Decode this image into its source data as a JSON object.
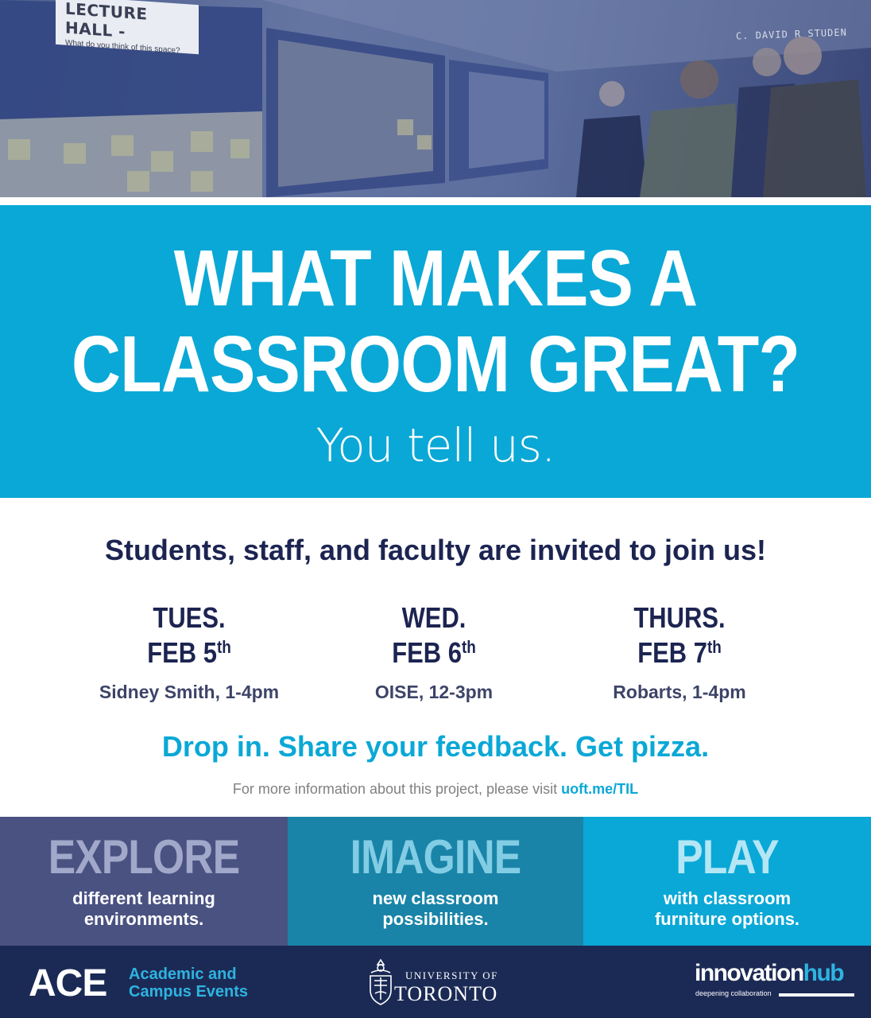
{
  "hero": {
    "sign_title": "LECTURE HALL -",
    "sign_subtitle": "What do you think of this space?",
    "wall_text": "C. DAVID     R  STUDEN"
  },
  "headline": {
    "line1": "WHAT MAKES A",
    "line2": "CLASSROOM GREAT?",
    "tagline": "You tell us."
  },
  "invite": "Students, staff, and faculty are invited to join us!",
  "events": [
    {
      "day": "TUES.",
      "date": "FEB 5",
      "suffix": "th",
      "location": "Sidney Smith, 1-4pm"
    },
    {
      "day": "WED.",
      "date": "FEB 6",
      "suffix": "th",
      "location": "OISE, 12-3pm"
    },
    {
      "day": "THURS.",
      "date": "FEB 7",
      "suffix": "th",
      "location": "Robarts, 1-4pm"
    }
  ],
  "cta": "Drop in. Share your feedback. Get pizza.",
  "info": {
    "text": "For more information about this project, please visit ",
    "link": "uoft.me/TIL"
  },
  "panels": [
    {
      "title": "EXPLORE",
      "line1": "different learning",
      "line2": "environments."
    },
    {
      "title": "IMAGINE",
      "line1": "new classroom",
      "line2": "possibilities."
    },
    {
      "title": "PLAY",
      "line1": "with classroom",
      "line2": "furniture options."
    }
  ],
  "footer": {
    "ace_abbr": "ACE",
    "ace_line1": "Academic and",
    "ace_line2": "Campus Events",
    "uoft_top": "UNIVERSITY OF",
    "uoft_main": "TORONTO",
    "ih_word1": "innovation",
    "ih_word2": "hub",
    "ih_tag": "deepening collaboration"
  },
  "colors": {
    "accent": "#0aa8d6",
    "navy": "#1c2451",
    "explore": "#4a5282",
    "imagine": "#1984a8",
    "play": "#0aa8d6",
    "footer": "#1b2a55"
  }
}
